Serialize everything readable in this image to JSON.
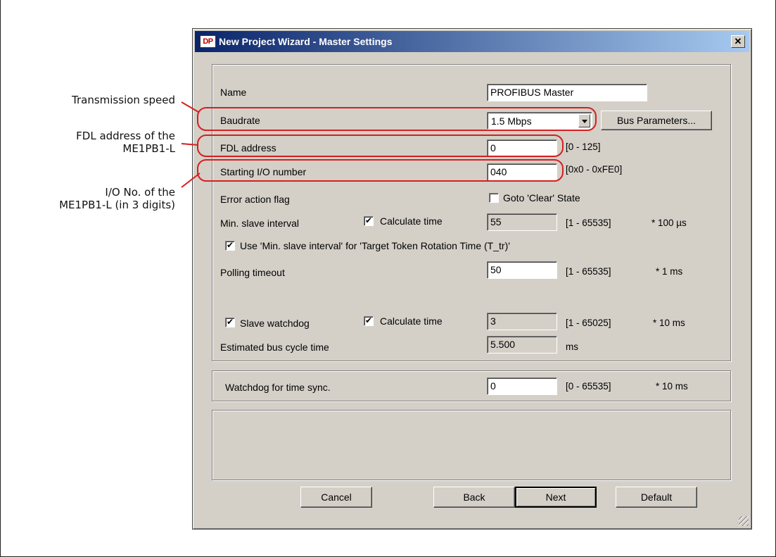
{
  "annotations": {
    "transmission_speed": "Transmission speed",
    "fdl_line1": "FDL address of the",
    "fdl_line2": "ME1PB1-L",
    "io_line1": "I/O No. of the",
    "io_line2": "ME1PB1-L (in 3 digits)",
    "highlight_color": "#d42020"
  },
  "dialog": {
    "logo": "DP",
    "title": "New Project Wizard - Master Settings",
    "close_glyph": "✕"
  },
  "fields": {
    "name_label": "Name",
    "name_value": "PROFIBUS Master",
    "baudrate_label": "Baudrate",
    "baudrate_value": "1.5 Mbps",
    "bus_parameters_button": "Bus Parameters...",
    "fdl_label": "FDL address",
    "fdl_value": "0",
    "fdl_range": "[0 - 125]",
    "io_label": "Starting I/O number",
    "io_value": "040",
    "io_range": "[0x0 - 0xFE0]",
    "error_flag_label": "Error action flag",
    "goto_clear_label": "Goto 'Clear' State",
    "goto_clear_checked": false,
    "min_slave_label": "Min. slave interval",
    "calc_time_label_1": "Calculate time",
    "calc_time_1_checked": true,
    "min_slave_value": "55",
    "min_slave_range": "[1 - 65535]",
    "min_slave_unit": "* 100 µs",
    "use_min_slave_label": "Use 'Min. slave interval' for 'Target Token Rotation Time (T_tr)'",
    "use_min_slave_checked": true,
    "polling_label": "Polling timeout",
    "polling_value": "50",
    "polling_range": "[1 - 65535]",
    "polling_unit": "* 1 ms",
    "slave_watchdog_label": "Slave watchdog",
    "slave_watchdog_checked": true,
    "calc_time_label_2": "Calculate time",
    "calc_time_2_checked": true,
    "slave_watchdog_value": "3",
    "slave_watchdog_range": "[1 - 65025]",
    "slave_watchdog_unit": "* 10 ms",
    "est_cycle_label": "Estimated bus cycle time",
    "est_cycle_value": "5.500",
    "est_cycle_unit": "ms",
    "watchdog_sync_label": "Watchdog for time sync.",
    "watchdog_sync_value": "0",
    "watchdog_sync_range": "[0 - 65535]",
    "watchdog_sync_unit": "* 10 ms"
  },
  "buttons": {
    "cancel": "Cancel",
    "back": "Back",
    "next": "Next",
    "default": "Default"
  }
}
